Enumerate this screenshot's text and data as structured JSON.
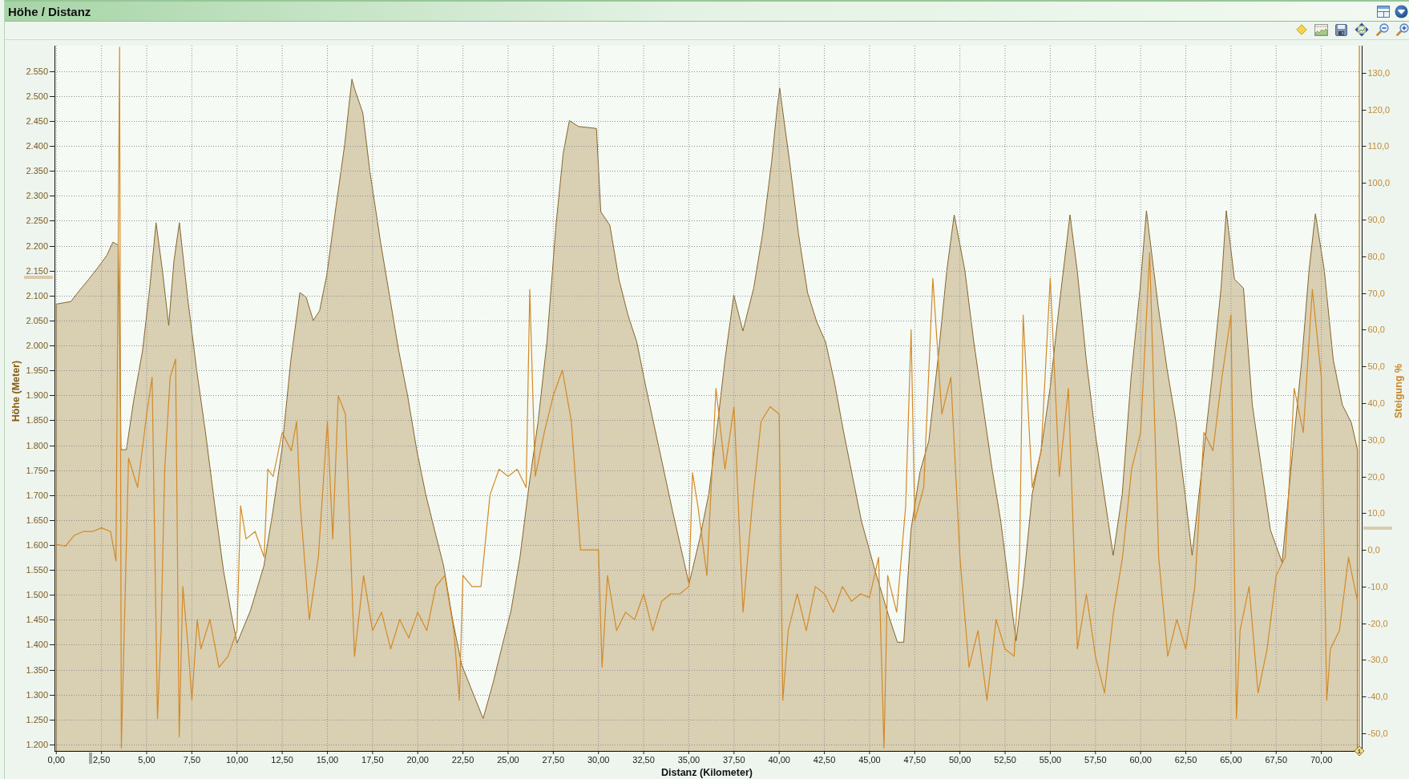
{
  "panel": {
    "title": "Höhe / Distanz"
  },
  "chart": {
    "chart_data": {
      "type": "area",
      "grid": true,
      "xlabel": "Distanz (Kilometer)",
      "ylabel": "Höhe (Meter)",
      "xlim": [
        -0.1,
        72.1
      ],
      "ylim": [
        1187,
        2601
      ],
      "xticks": [
        {
          "value": 0,
          "label": "0,00"
        },
        {
          "value": 2.5,
          "label": "2,50"
        },
        {
          "value": 5,
          "label": "5,00"
        },
        {
          "value": 7.5,
          "label": "7,50"
        },
        {
          "value": 10,
          "label": "10,00"
        },
        {
          "value": 12.5,
          "label": "12,50"
        },
        {
          "value": 15,
          "label": "15,00"
        },
        {
          "value": 17.5,
          "label": "17,50"
        },
        {
          "value": 20,
          "label": "20,00"
        },
        {
          "value": 22.5,
          "label": "22,50"
        },
        {
          "value": 25,
          "label": "25,00"
        },
        {
          "value": 27.5,
          "label": "27,50"
        },
        {
          "value": 30,
          "label": "30,00"
        },
        {
          "value": 32.5,
          "label": "32,50"
        },
        {
          "value": 35,
          "label": "35,00"
        },
        {
          "value": 37.5,
          "label": "37,50"
        },
        {
          "value": 40,
          "label": "40,00"
        },
        {
          "value": 42.5,
          "label": "42,50"
        },
        {
          "value": 45,
          "label": "45,00"
        },
        {
          "value": 47.5,
          "label": "47,50"
        },
        {
          "value": 50,
          "label": "50,00"
        },
        {
          "value": 52.5,
          "label": "52,50"
        },
        {
          "value": 55,
          "label": "55,00"
        },
        {
          "value": 57.5,
          "label": "57,50"
        },
        {
          "value": 60,
          "label": "60,00"
        },
        {
          "value": 62.5,
          "label": "62,50"
        },
        {
          "value": 65,
          "label": "65,00"
        },
        {
          "value": 67.5,
          "label": "67,50"
        },
        {
          "value": 70,
          "label": "70,00"
        }
      ],
      "yticks": [
        {
          "value": 1200,
          "label": "1.200"
        },
        {
          "value": 1250,
          "label": "1.250"
        },
        {
          "value": 1300,
          "label": "1.300"
        },
        {
          "value": 1350,
          "label": "1.350"
        },
        {
          "value": 1400,
          "label": "1.400"
        },
        {
          "value": 1450,
          "label": "1.450"
        },
        {
          "value": 1500,
          "label": "1.500"
        },
        {
          "value": 1550,
          "label": "1.550"
        },
        {
          "value": 1600,
          "label": "1.600"
        },
        {
          "value": 1650,
          "label": "1.650"
        },
        {
          "value": 1700,
          "label": "1.700"
        },
        {
          "value": 1750,
          "label": "1.750"
        },
        {
          "value": 1800,
          "label": "1.800"
        },
        {
          "value": 1850,
          "label": "1.850"
        },
        {
          "value": 1900,
          "label": "1.900"
        },
        {
          "value": 1950,
          "label": "1.950"
        },
        {
          "value": 2000,
          "label": "2.000"
        },
        {
          "value": 2050,
          "label": "2.050"
        },
        {
          "value": 2100,
          "label": "2.100"
        },
        {
          "value": 2150,
          "label": "2.150"
        },
        {
          "value": 2200,
          "label": "2.200"
        },
        {
          "value": 2250,
          "label": "2.250"
        },
        {
          "value": 2300,
          "label": "2.300"
        },
        {
          "value": 2350,
          "label": "2.350"
        },
        {
          "value": 2400,
          "label": "2.400"
        },
        {
          "value": 2450,
          "label": "2.450"
        },
        {
          "value": 2500,
          "label": "2.500"
        },
        {
          "value": 2550,
          "label": "2.550"
        }
      ],
      "x": [
        0,
        0.8,
        1.3,
        1.8,
        2.3,
        2.8,
        3.13,
        3.43,
        3.48,
        3.58,
        3.88,
        4.28,
        4.77,
        5.17,
        5.52,
        5.87,
        6.22,
        6.51,
        6.81,
        7.26,
        7.76,
        8.25,
        8.75,
        9.25,
        9.65,
        10.0,
        10.74,
        11.49,
        11.98,
        12.48,
        12.98,
        13.48,
        13.82,
        14.22,
        14.57,
        14.97,
        15.47,
        15.96,
        16.22,
        16.36,
        16.5,
        16.96,
        17.35,
        17.95,
        18.45,
        18.95,
        19.44,
        19.94,
        20.44,
        20.93,
        21.43,
        21.93,
        22.43,
        22.92,
        23.62,
        24.17,
        24.66,
        25.16,
        25.66,
        26.16,
        26.65,
        27.15,
        27.65,
        28.05,
        28.39,
        28.89,
        29.89,
        30.13,
        30.63,
        31.13,
        31.63,
        32.12,
        32.62,
        33.37,
        34.11,
        35.01,
        35.6,
        36.1,
        36.6,
        37.0,
        37.49,
        37.99,
        38.59,
        39.08,
        39.58,
        39.9,
        40.03,
        40.16,
        40.58,
        41.07,
        41.57,
        42.07,
        42.57,
        43.06,
        43.56,
        44.06,
        44.55,
        45.3,
        46.05,
        46.54,
        46.89,
        47.29,
        47.79,
        48.28,
        48.78,
        49.28,
        49.68,
        50.27,
        50.77,
        51.27,
        51.77,
        52.26,
        52.76,
        53.11,
        53.51,
        54.0,
        54.5,
        55.0,
        55.49,
        56.09,
        56.49,
        56.99,
        57.48,
        57.98,
        58.48,
        58.98,
        59.47,
        59.97,
        60.32,
        60.97,
        61.46,
        61.96,
        62.46,
        62.85,
        63.45,
        63.95,
        64.45,
        64.74,
        65.19,
        65.69,
        66.18,
        66.68,
        67.18,
        67.83,
        68.42,
        68.92,
        69.32,
        69.67,
        70.16,
        70.66,
        71.16,
        71.66,
        72.0
      ],
      "series": [
        {
          "color": "#d9cfb3",
          "values": [
            2083,
            2088,
            2111,
            2133,
            2156,
            2181,
            2207,
            2201,
            2097,
            1791,
            1791,
            1890,
            1989,
            2115,
            2246,
            2151,
            2040,
            2169,
            2246,
            2097,
            1953,
            1827,
            1684,
            1549,
            1468,
            1403,
            1468,
            1558,
            1666,
            1791,
            1971,
            2106,
            2097,
            2050,
            2070,
            2142,
            2277,
            2403,
            2490,
            2534,
            2515,
            2466,
            2349,
            2205,
            2097,
            1989,
            1899,
            1791,
            1702,
            1630,
            1558,
            1450,
            1360,
            1315,
            1252,
            1324,
            1396,
            1468,
            1576,
            1720,
            1845,
            2007,
            2241,
            2385,
            2451,
            2439,
            2435,
            2268,
            2241,
            2133,
            2061,
            2007,
            1917,
            1791,
            1666,
            1522,
            1612,
            1702,
            1845,
            1971,
            2101,
            2029,
            2115,
            2223,
            2367,
            2480,
            2516,
            2480,
            2367,
            2223,
            2106,
            2048,
            2007,
            1926,
            1827,
            1737,
            1648,
            1549,
            1459,
            1405,
            1405,
            1630,
            1746,
            1809,
            1971,
            2151,
            2262,
            2151,
            2007,
            1881,
            1755,
            1648,
            1504,
            1408,
            1522,
            1702,
            1791,
            1917,
            2079,
            2262,
            2151,
            1971,
            1827,
            1702,
            1579,
            1702,
            1935,
            2115,
            2270,
            2079,
            1953,
            1845,
            1702,
            1579,
            1773,
            1935,
            2115,
            2270,
            2133,
            2115,
            1881,
            1755,
            1630,
            1565,
            1791,
            1971,
            2151,
            2264,
            2151,
            1971,
            1881,
            1845,
            1791
          ]
        }
      ]
    }
  },
  "gradient_chart": {
    "chart_data": {
      "type": "line",
      "ylabel": "Steigung %",
      "xlim": [
        -0.1,
        72.1
      ],
      "ylim": [
        -54.8,
        137.4
      ],
      "yticks": [
        {
          "value": -50,
          "label": "-50,0"
        },
        {
          "value": -40,
          "label": "-40,0"
        },
        {
          "value": -30,
          "label": "-30,0"
        },
        {
          "value": -20,
          "label": "-20,0"
        },
        {
          "value": -10,
          "label": "-10,0"
        },
        {
          "value": 0,
          "label": "0,0"
        },
        {
          "value": 10,
          "label": "10,0"
        },
        {
          "value": 20,
          "label": "20,0"
        },
        {
          "value": 30,
          "label": "30,0"
        },
        {
          "value": 40,
          "label": "40,0"
        },
        {
          "value": 50,
          "label": "50,0"
        },
        {
          "value": 60,
          "label": "60,0"
        },
        {
          "value": 70,
          "label": "70,0"
        },
        {
          "value": 80,
          "label": "80,0"
        },
        {
          "value": 90,
          "label": "90,0"
        },
        {
          "value": 100,
          "label": "100,0"
        },
        {
          "value": 110,
          "label": "110,0"
        },
        {
          "value": 120,
          "label": "120,0"
        },
        {
          "value": 130,
          "label": "130,0"
        }
      ],
      "x": [
        0,
        0.5,
        1,
        1.5,
        2,
        2.5,
        3,
        3.3,
        3.5,
        3.6,
        4,
        4.5,
        5,
        5.3,
        5.6,
        5.8,
        6,
        6.3,
        6.6,
        6.8,
        7,
        7.3,
        7.5,
        7.8,
        8,
        8.5,
        9,
        9.5,
        10,
        10.2,
        10.5,
        11,
        11.5,
        11.7,
        12,
        12.5,
        13,
        13.3,
        13.5,
        14,
        14.5,
        15,
        15.3,
        15.6,
        16,
        16.3,
        16.5,
        17,
        17.5,
        18,
        18.5,
        19,
        19.5,
        20,
        20.5,
        21,
        21.5,
        22,
        22.3,
        22.5,
        23,
        23.5,
        24,
        24.5,
        25,
        25.5,
        26,
        26.2,
        26.5,
        27,
        27.5,
        28,
        28.5,
        29,
        29.5,
        30,
        30.2,
        30.5,
        31,
        31.5,
        32,
        32.5,
        33,
        33.5,
        34,
        34.5,
        35,
        35.2,
        35.5,
        36,
        36.5,
        37,
        37.5,
        38,
        38.5,
        39,
        39.5,
        40,
        40.2,
        40.5,
        41,
        41.5,
        42,
        42.5,
        43,
        43.5,
        44,
        44.5,
        45,
        45.5,
        45.8,
        46,
        46.5,
        47,
        47.3,
        47.5,
        48,
        48.5,
        49,
        49.5,
        50,
        50.5,
        51,
        51.5,
        52,
        52.5,
        53,
        53.3,
        53.5,
        54,
        54.5,
        55,
        55.5,
        56,
        56.5,
        57,
        57.5,
        58,
        58.5,
        59,
        59.5,
        60,
        60.5,
        61,
        61.5,
        62,
        62.5,
        63,
        63.5,
        64,
        64.5,
        65,
        65.3,
        65.5,
        66,
        66.5,
        67,
        67.5,
        68,
        68.5,
        69,
        69.5,
        70,
        70.3,
        70.5,
        71,
        71.5,
        72
      ],
      "series": [
        {
          "color": "#d38a26",
          "values": [
            1.5,
            1,
            4,
            5,
            5,
            6,
            5,
            -3,
            137,
            -54,
            25,
            17,
            37,
            47,
            -46,
            -22,
            22,
            47,
            52,
            -51,
            -10,
            -27,
            -41,
            -19,
            -27,
            -19,
            -32,
            -29,
            -22,
            12,
            3,
            5,
            -2,
            22,
            20,
            32,
            27,
            35,
            12,
            -19,
            -2,
            35,
            3,
            42,
            37,
            -2,
            -29,
            -7,
            -22,
            -17,
            -27,
            -19,
            -24,
            -17,
            -22,
            -10,
            -7,
            -22,
            -41,
            -7,
            -10,
            -10,
            15,
            22,
            20,
            22,
            17,
            71,
            20,
            32,
            42,
            49,
            35,
            0,
            0,
            0,
            -32,
            -7,
            -22,
            -17,
            -19,
            -12,
            -22,
            -14,
            -12,
            -12,
            -10,
            21,
            12,
            -7,
            44,
            22,
            39,
            -17,
            12,
            35,
            39,
            37,
            -41,
            -22,
            -12,
            -22,
            -10,
            -12,
            -17,
            -10,
            -14,
            -12,
            -13,
            -2,
            -54,
            -7,
            -17,
            12,
            60,
            8,
            17,
            74,
            37,
            47,
            -2,
            -32,
            -22,
            -41,
            -19,
            -27,
            -29,
            -2,
            64,
            17,
            27,
            74,
            20,
            44,
            -27,
            -12,
            -29,
            -39,
            -17,
            -2,
            22,
            32,
            81,
            -2,
            -29,
            -19,
            -27,
            -10,
            32,
            27,
            47,
            64,
            -46,
            -22,
            -10,
            -39,
            -27,
            -7,
            -2,
            44,
            32,
            71,
            47,
            -41,
            -27,
            -22,
            -2,
            -14
          ]
        }
      ]
    }
  },
  "cursor": {
    "label": "1"
  }
}
